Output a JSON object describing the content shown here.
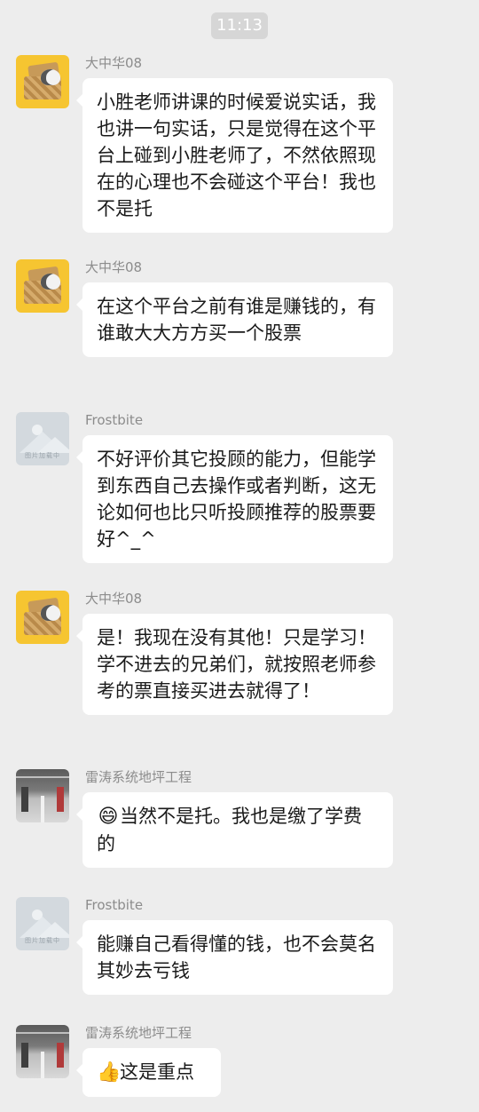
{
  "time": "11:13",
  "messages": [
    {
      "sender": "大中华08",
      "avatar": "cat-in-basket-avatar",
      "text": "小胜老师讲课的时候爱说实话，我也讲一句实话，只是觉得在这个平台上碰到小胜老师了，不然依照现在的心理也不会碰这个平台！我也不是托"
    },
    {
      "sender": "大中华08",
      "avatar": "cat-in-basket-avatar",
      "text": "在这个平台之前有谁是赚钱的，有谁敢大大方方买一个股票"
    },
    {
      "sender": "Frostbite",
      "avatar": "placeholder-image-avatar",
      "avatar_text": "图片加载中",
      "text": "不好评价其它投顾的能力，但能学到东西自己去操作或者判断，这无论如何也比只听投顾推荐的股票要好^_^"
    },
    {
      "sender": "大中华08",
      "avatar": "cat-in-basket-avatar",
      "text": "是！我现在没有其他！只是学习！学不进去的兄弟们，就按照老师参考的票直接买进去就得了！"
    },
    {
      "sender": "雷涛系统地坪工程",
      "avatar": "parking-garage-avatar",
      "emoji": "😄",
      "text": "当然不是托。我也是缴了学费的"
    },
    {
      "sender": "Frostbite",
      "avatar": "placeholder-image-avatar",
      "avatar_text": "图片加载中",
      "text": "能赚自己看得懂的钱，也不会莫名其妙去亏钱"
    },
    {
      "sender": "雷涛系统地坪工程",
      "avatar": "parking-garage-avatar",
      "emoji": "👍",
      "text": "这是重点"
    }
  ]
}
